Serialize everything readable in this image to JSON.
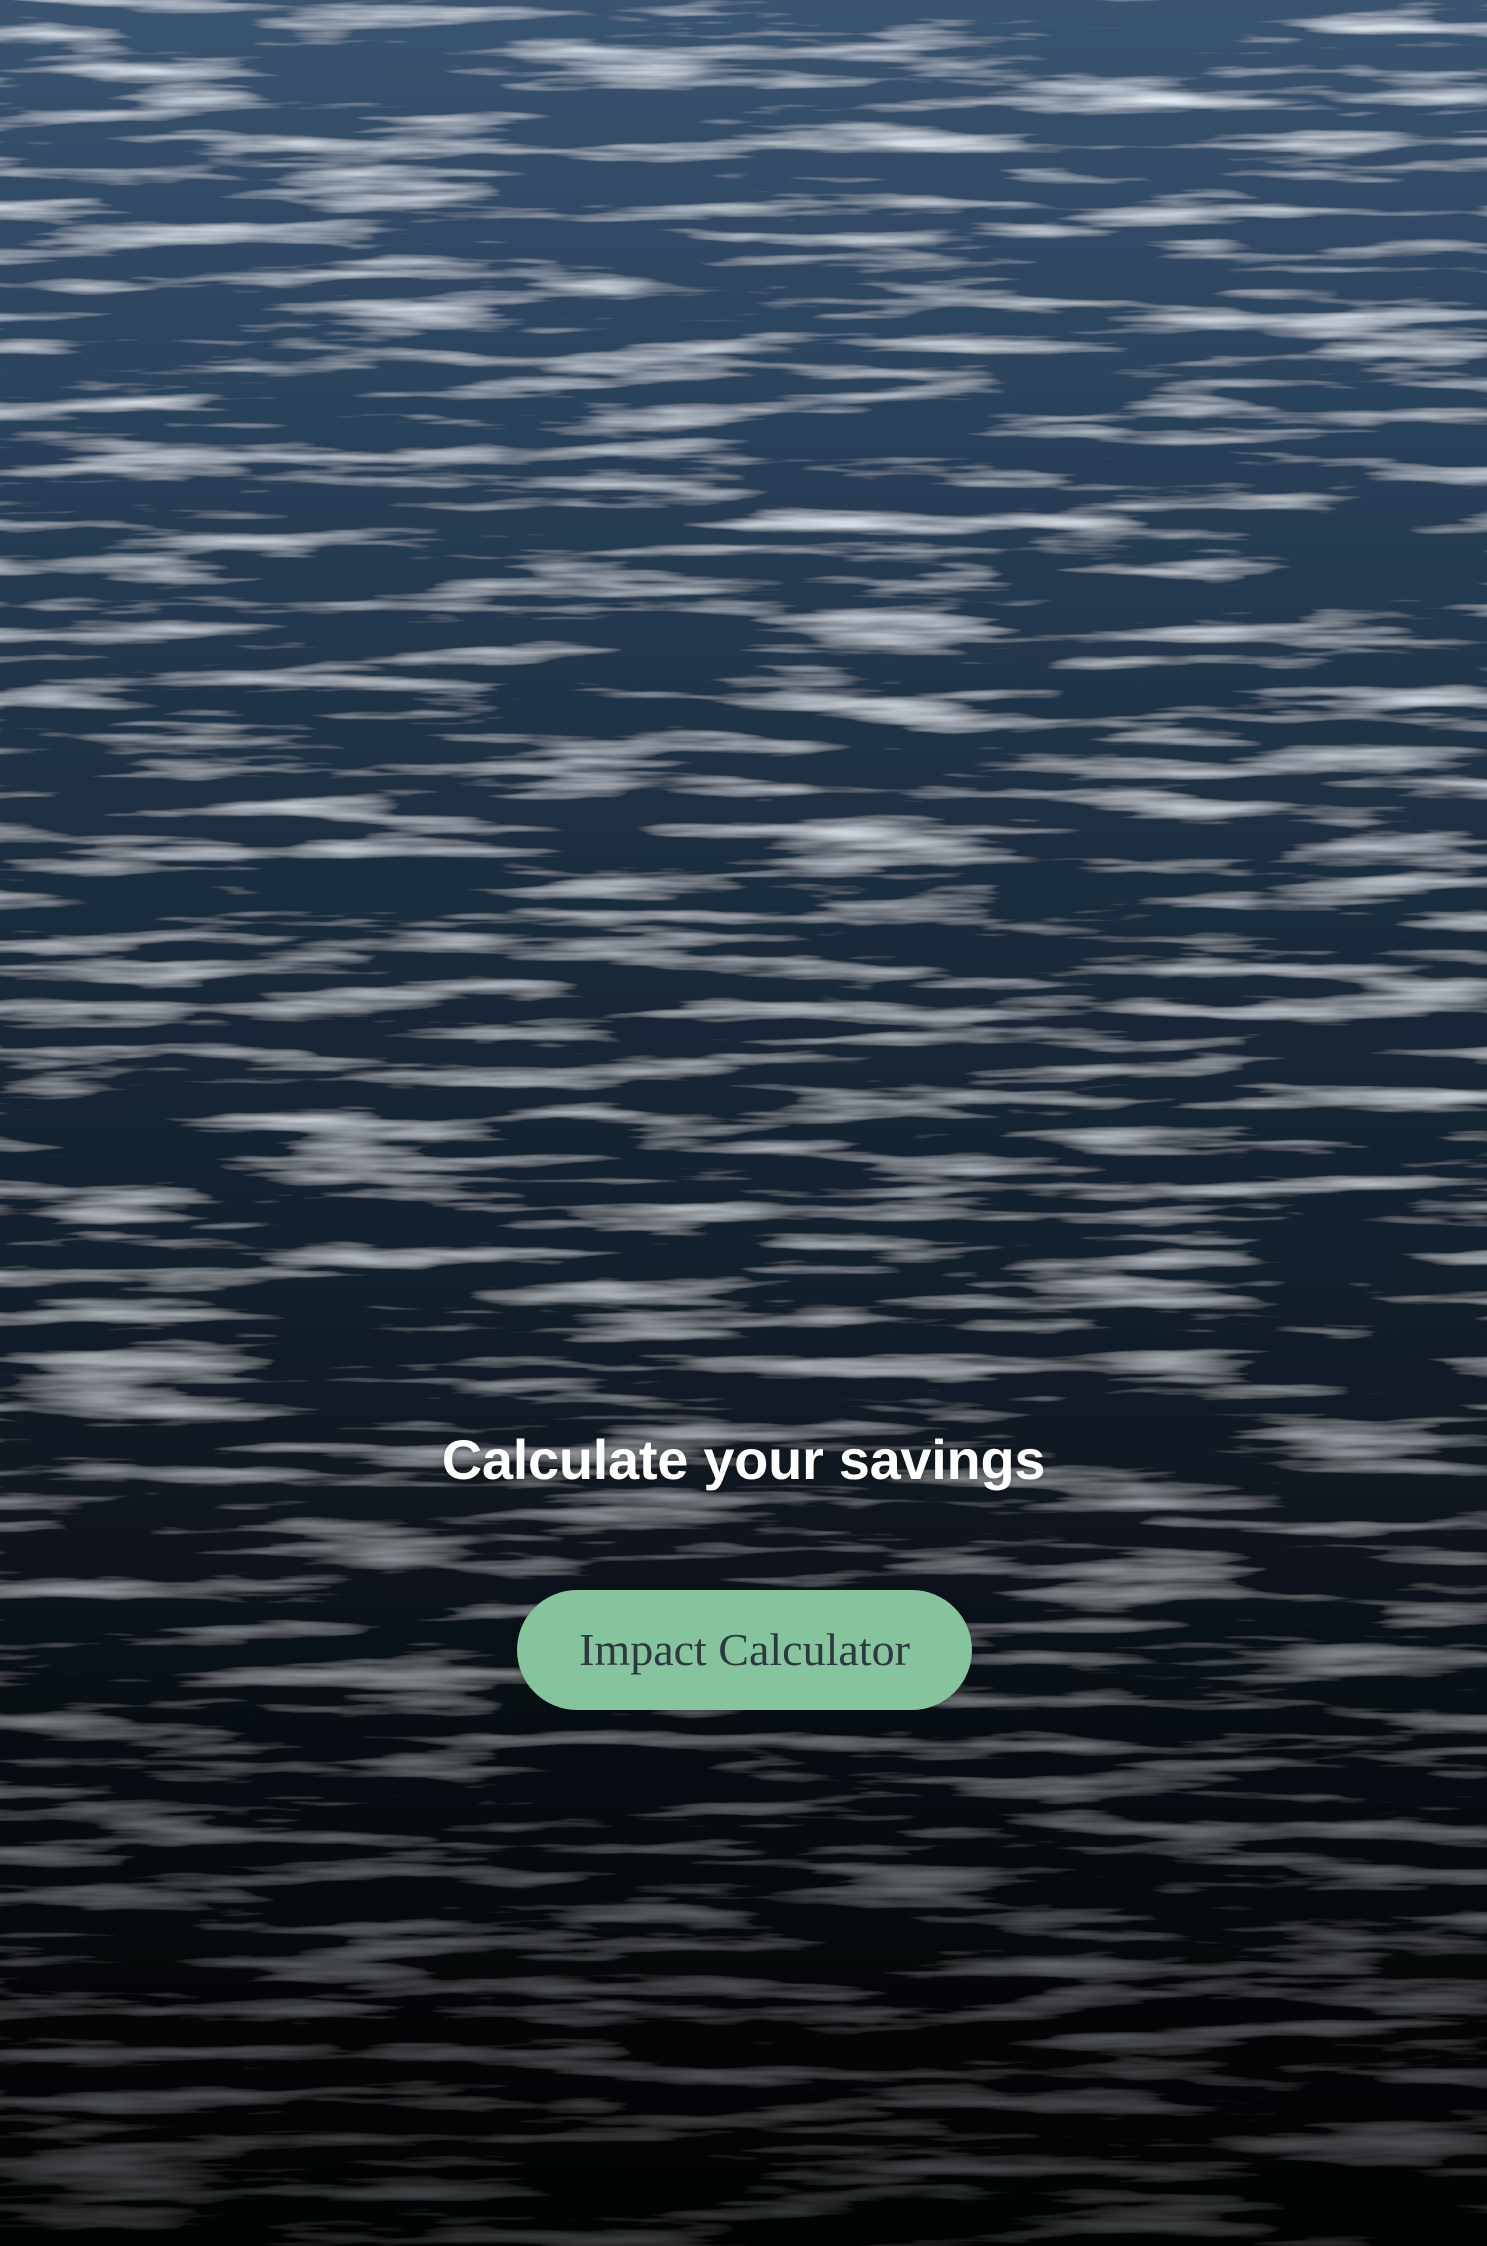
{
  "hero": {
    "title": "Calculate your savings",
    "button_label": "Impact Calculator",
    "background": "ocean-water-photo"
  },
  "colors": {
    "button_bg": "#86c49d",
    "button_text": "#2e3840",
    "title_text": "#ffffff",
    "water_dark": "#0b141d",
    "water_mid": "#2a3f55"
  }
}
